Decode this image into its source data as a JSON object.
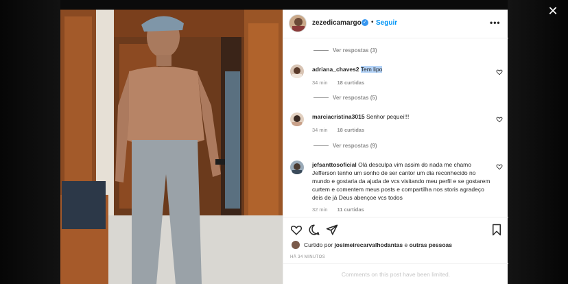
{
  "post": {
    "username": "zezedicamargo",
    "follow_label": "Seguir",
    "separator": "•",
    "more_glyph": "•••"
  },
  "comments": [
    {
      "replies_label": "Ver respostas (3)"
    },
    {
      "username": "adriana_chaves2",
      "text": "Tem lipo",
      "time": "34 min",
      "likes": "18 curtidas",
      "replies_label": "Ver respostas (5)"
    },
    {
      "username": "marciacristina3015",
      "text": "Senhor pequei!!!",
      "time": "34 min",
      "likes": "18 curtidas",
      "replies_label": "Ver respostas (9)"
    },
    {
      "username": "jefsanttosoficial",
      "text": "Olá desculpa vim assim do nada me chamo Jefferson tenho um sonho de ser cantor um dia reconhecido no mundo e gostaria da ajuda de vcs visitando meu perfil e se gostarem curtem e comentem meus posts e compartilha nos storis agradeço deis de já Deus abençoe vcs todos",
      "time": "32 min",
      "likes": "11 curtidas"
    }
  ],
  "likes_line": {
    "prefix": "Curtido por",
    "user": "josimeirecarvalhodantas",
    "connector": "e",
    "others": "outras pessoas"
  },
  "timestamp": "HÁ 34 MINUTOS",
  "comments_limited": "Comments on this post have been limited.",
  "colors": {
    "link_blue": "#0095f6",
    "verified_blue": "#3897f0",
    "secondary_text": "#8e8e8e",
    "highlight": "#b4d3f7"
  }
}
